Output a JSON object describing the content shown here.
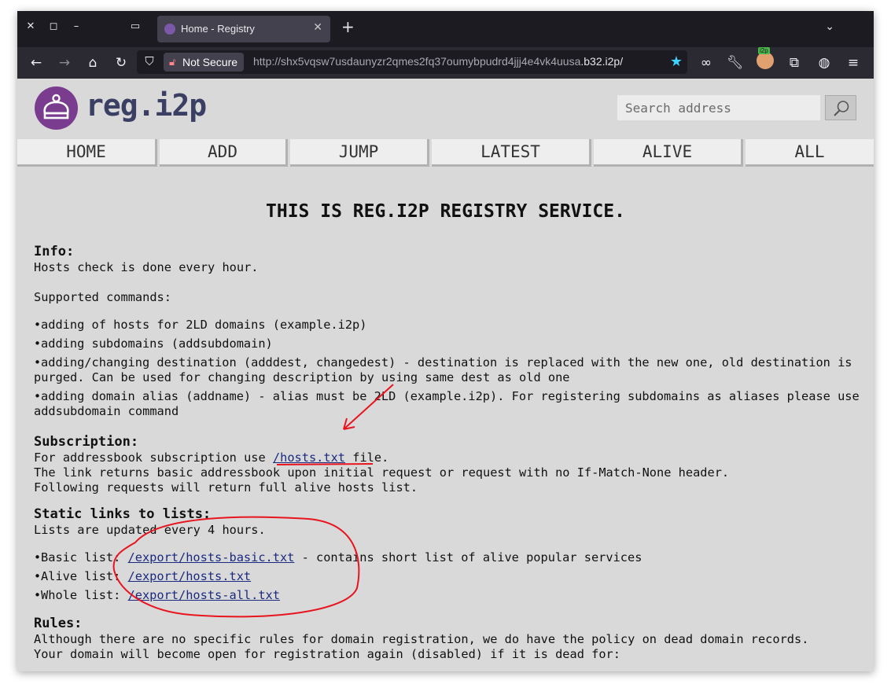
{
  "browser": {
    "tab_title": "Home - Registry",
    "not_secure_label": "Not Secure",
    "url_path": "http://shx5vqsw7usdaunyzr2qmes2fq37oumybpudrd4jjj4e4vk4uusa",
    "url_host": ".b32.i2p/",
    "extension_badge": "i2p"
  },
  "site": {
    "logo_text": "reg.i2p",
    "search_placeholder": "Search address"
  },
  "menu": [
    "HOME",
    "ADD",
    "JUMP",
    "LATEST",
    "ALIVE",
    "ALL"
  ],
  "page": {
    "title": "THIS IS REG.I2P REGISTRY SERVICE.",
    "info_heading": "Info:",
    "info_text": "Hosts check is done every hour.",
    "commands_intro": "Supported commands:",
    "commands": [
      "adding of hosts for 2LD domains (example.i2p)",
      "adding subdomains (addsubdomain)",
      "adding/changing destination (adddest, changedest) - destination is replaced with the new one, old destination is purged. Can be used for changing description by using same dest as old one",
      "adding domain alias (addname) - alias must be 2LD (example.i2p). For registering subdomains as aliases please use addsubdomain command"
    ],
    "subscription_heading": "Subscription:",
    "subscription_pre": "For addressbook subscription use ",
    "subscription_link": "/hosts.txt",
    "subscription_post": " file.",
    "subscription_line2": "The link returns basic addressbook upon initial request or request with no If-Match-None header.",
    "subscription_line3": "Following requests will return full alive hosts list.",
    "static_heading": "Static links to lists:",
    "static_text": "Lists are updated every 4 hours.",
    "lists": [
      {
        "label": "Basic list: ",
        "link": "/export/hosts-basic.txt",
        "suffix": " - contains short list of alive popular services"
      },
      {
        "label": "Alive list: ",
        "link": "/export/hosts.txt",
        "suffix": ""
      },
      {
        "label": "Whole list: ",
        "link": "/export/hosts-all.txt",
        "suffix": ""
      }
    ],
    "rules_heading": "Rules:",
    "rules_line1": "Although there are no specific rules for domain registration, we do have the policy on dead domain records.",
    "rules_line2": "Your domain will become open for registration again (disabled) if it is dead for:"
  },
  "colors": {
    "annotation": "#e8141e",
    "link": "#1a2a80",
    "logo_purple": "#7a3c8e",
    "logo_text": "#3b3f63"
  }
}
